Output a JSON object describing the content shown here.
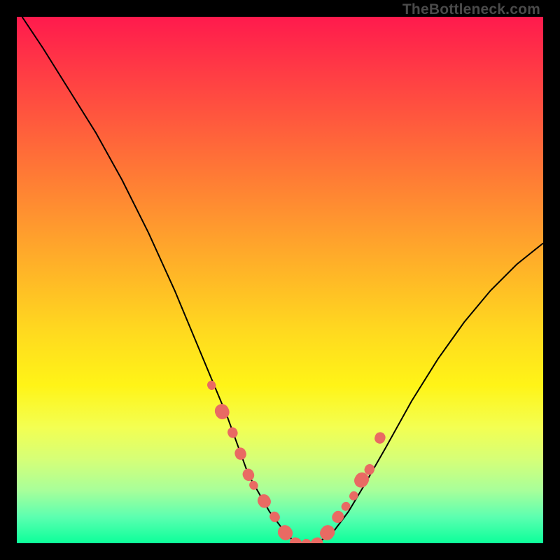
{
  "watermark": "TheBottleneck.com",
  "colors": {
    "frame": "#000000",
    "gradient_top": "#ff1a4d",
    "gradient_bottom": "#0cff9a",
    "marker": "#e96a63",
    "line": "#000000"
  },
  "chart_data": {
    "type": "line",
    "title": "",
    "xlabel": "",
    "ylabel": "",
    "xlim": [
      0,
      100
    ],
    "ylim": [
      0,
      100
    ],
    "grid": false,
    "legend": false,
    "series": [
      {
        "name": "bottleneck-curve",
        "x": [
          1,
          5,
          10,
          15,
          20,
          25,
          30,
          35,
          40,
          44,
          48,
          51,
          53,
          55,
          57,
          60,
          63,
          66,
          70,
          75,
          80,
          85,
          90,
          95,
          100
        ],
        "y": [
          100,
          94,
          86,
          78,
          69,
          59,
          48,
          36,
          24,
          13,
          6,
          2,
          0,
          0,
          0,
          2,
          6,
          11,
          18,
          27,
          35,
          42,
          48,
          53,
          57
        ]
      }
    ],
    "markers": {
      "name": "highlight-points",
      "x": [
        37,
        39,
        41,
        42.5,
        44,
        45,
        47,
        49,
        51,
        53,
        55,
        57,
        59,
        61,
        62.5,
        64,
        65.5,
        67,
        69
      ],
      "y": [
        30,
        25,
        21,
        17,
        13,
        11,
        8,
        5,
        2,
        0,
        0,
        0,
        2,
        5,
        7,
        9,
        12,
        14,
        20
      ],
      "sizes": [
        12,
        20,
        14,
        16,
        16,
        12,
        18,
        14,
        20,
        16,
        12,
        16,
        20,
        16,
        12,
        12,
        20,
        14,
        15
      ]
    }
  }
}
